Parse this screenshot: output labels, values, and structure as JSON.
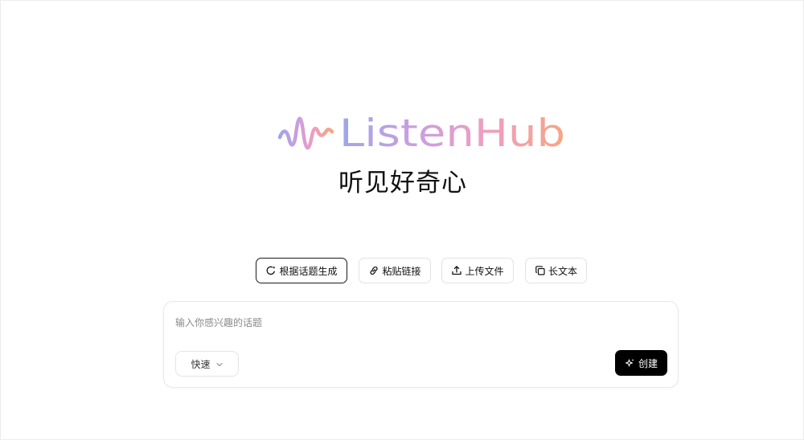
{
  "brand": {
    "name": "ListenHub",
    "tagline": "听见好奇心",
    "gradient": [
      "#a6a2e6",
      "#c79ae0",
      "#ef9fbf",
      "#f6a585"
    ]
  },
  "tabs": [
    {
      "label": "根据话题生成",
      "icon": "sparkle-refresh-icon",
      "active": true
    },
    {
      "label": "粘贴链接",
      "icon": "link-icon",
      "active": false
    },
    {
      "label": "上传文件",
      "icon": "upload-icon",
      "active": false
    },
    {
      "label": "长文本",
      "icon": "copy-icon",
      "active": false
    }
  ],
  "composer": {
    "placeholder": "输入你感兴趣的话题",
    "value": "",
    "mode_label": "快速",
    "mode_icon": "chevron-down-icon",
    "create_label": "创建",
    "create_icon": "sparkles-icon"
  }
}
